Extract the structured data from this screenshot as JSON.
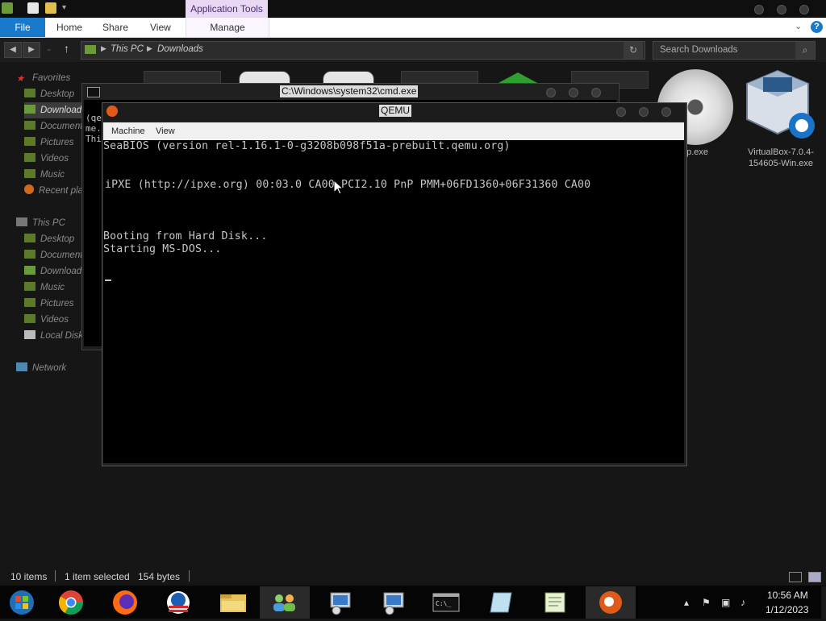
{
  "explorer": {
    "ribbon": {
      "contextual_tab": "Application Tools",
      "file_tab": "File",
      "tabs": [
        "Home",
        "Share",
        "View"
      ],
      "manage_tab": "Manage"
    },
    "address": {
      "segments": [
        "This PC",
        "Downloads"
      ]
    },
    "search_placeholder": "Search Downloads",
    "sidebar": {
      "favorites_header": "Favorites",
      "favorites": [
        "Desktop",
        "Downloads",
        "Documents",
        "Pictures",
        "Videos",
        "Music",
        "Recent places"
      ],
      "thispc_header": "This PC",
      "thispc": [
        "Desktop",
        "Documents",
        "Downloads",
        "Music",
        "Pictures",
        "Videos",
        "Local Disk"
      ],
      "network": "Network"
    },
    "desktop_icons": [
      {
        "name": "dvd-setup-icon",
        "label": "up.exe"
      },
      {
        "name": "virtualbox-installer-icon",
        "label_line1": "VirtualBox-7.0.4-",
        "label_line2": "154605-Win.exe"
      }
    ],
    "status": {
      "items": "10 items",
      "selected": "1 item selected",
      "size": "154 bytes"
    }
  },
  "cmd": {
    "title": "C:\\Windows\\system32\\cmd.exe",
    "lines": [
      "(qe",
      "me.",
      "Thi"
    ]
  },
  "qemu": {
    "title": "QEMU",
    "menu": [
      "Machine",
      "View"
    ],
    "screen": {
      "line1": "SeaBIOS (version rel-1.16.1-0-g3208b098f51a-prebuilt.qemu.org)",
      "line2": "iPXE (http://ipxe.org) 00:03.0 CA00 PCI2.10 PnP PMM+06FD1360+06F31360 CA00",
      "line3": "Booting from Hard Disk...",
      "line4": "Starting MS-DOS..."
    }
  },
  "taskbar": {
    "apps": [
      "start-orb-icon",
      "chrome-icon",
      "firefox-icon",
      "obama-logo-icon",
      "file-explorer-icon",
      "people-icon",
      "network-install-icon",
      "network-setup-icon",
      "cmd-icon",
      "notepad-icon",
      "editor-icon",
      "qemu-icon"
    ],
    "clock": {
      "time": "10:56 AM",
      "date": "1/12/2023"
    }
  },
  "colors": {
    "accent": "#1979ca",
    "app_tools": "#e8d8f4"
  }
}
